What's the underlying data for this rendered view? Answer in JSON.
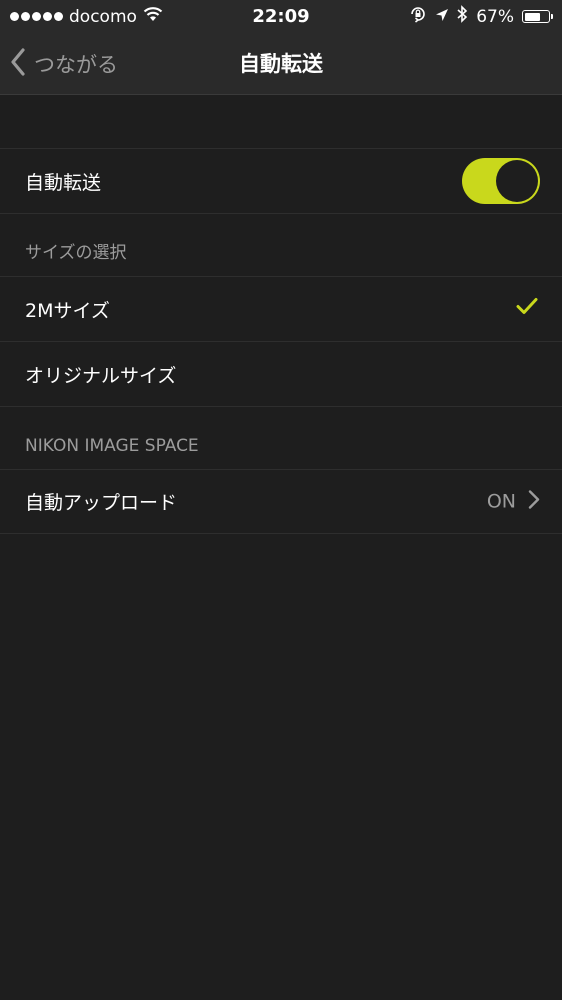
{
  "status_bar": {
    "carrier": "docomo",
    "time": "22:09",
    "battery_percent": "67%",
    "battery_level": 0.67,
    "icons": [
      "signal-dots-icon",
      "wifi-icon",
      "orientation-lock-icon",
      "location-icon",
      "bluetooth-icon",
      "battery-icon"
    ]
  },
  "nav": {
    "back_label": "つながる",
    "title": "自動転送"
  },
  "auto_transfer": {
    "label": "自動転送",
    "enabled": true
  },
  "size_section": {
    "header": "サイズの選択",
    "options": [
      {
        "label": "2Mサイズ",
        "selected": true
      },
      {
        "label": "オリジナルサイズ",
        "selected": false
      }
    ]
  },
  "nikon_section": {
    "header": "NIKON IMAGE SPACE",
    "auto_upload_label": "自動アップロード",
    "auto_upload_value": "ON"
  },
  "colors": {
    "accent": "#c9d81c",
    "background": "#1e1e1e",
    "bar": "#2a2a2a",
    "secondary_text": "#9c9c9c"
  }
}
